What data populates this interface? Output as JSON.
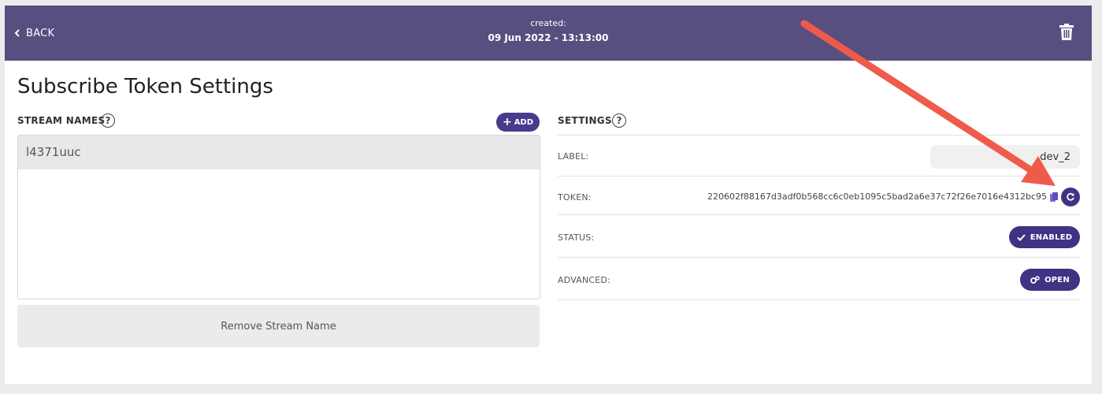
{
  "header": {
    "back_label": "BACK",
    "created_label": "created:",
    "created_value": "09 Jun 2022 - 13:13:00"
  },
  "page_title": "Subscribe Token Settings",
  "stream_names": {
    "section_label": "STREAM NAMES",
    "help": "?",
    "add_label": "ADD",
    "items": [
      "l4371uuc"
    ],
    "remove_label": "Remove Stream Name"
  },
  "settings": {
    "section_label": "SETTINGS",
    "help": "?",
    "label_label": "LABEL:",
    "label_value": "dev_2",
    "token_label": "TOKEN:",
    "token_value": "220602f88167d3adf0b568cc6c0eb1095c5bad2a6e37c72f26e7016e4312bc95",
    "status_label": "STATUS:",
    "status_button": "ENABLED",
    "advanced_label": "ADVANCED:",
    "advanced_button": "OPEN"
  },
  "colors": {
    "header_bg": "#584e80",
    "accent": "#3f3384",
    "annotation_arrow": "#ef5b4b"
  }
}
